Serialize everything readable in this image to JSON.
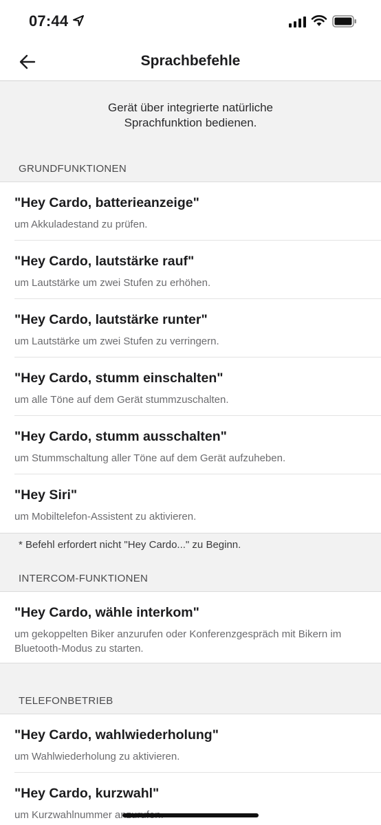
{
  "status_bar": {
    "time": "07:44",
    "location_icon": "location-arrow-icon",
    "signal_icon": "cellular-signal-icon",
    "wifi_icon": "wifi-icon",
    "battery_icon": "battery-icon"
  },
  "nav": {
    "back_icon": "arrow-left-icon",
    "title": "Sprachbefehle"
  },
  "intro": {
    "line1": "Gerät über integrierte natürliche",
    "line2": "Sprachfunktion bedienen."
  },
  "sections": {
    "grundfunktionen": {
      "header": "GRUNDFUNKTIONEN",
      "items": [
        {
          "command": "\"Hey Cardo, batterieanzeige\"",
          "description": "um Akkuladestand zu prüfen."
        },
        {
          "command": "\"Hey Cardo, lautstärke rauf\"",
          "description": "um Lautstärke um zwei Stufen zu erhöhen."
        },
        {
          "command": "\"Hey Cardo, lautstärke runter\"",
          "description": "um Lautstärke um zwei Stufen zu verringern."
        },
        {
          "command": "\"Hey Cardo, stumm einschalten\"",
          "description": "um alle Töne auf dem Gerät stummzuschalten."
        },
        {
          "command": "\"Hey Cardo, stumm ausschalten\"",
          "description": "um Stummschaltung aller Töne auf dem Gerät aufzuheben."
        },
        {
          "command": "\"Hey Siri\"",
          "description": "um Mobiltelefon-Assistent zu aktivieren."
        }
      ],
      "note": "* Befehl erfordert nicht \"Hey Cardo...\" zu Beginn."
    },
    "intercom": {
      "header": "INTERCOM-FUNKTIONEN",
      "items": [
        {
          "command": "\"Hey Cardo, wähle interkom\"",
          "description": "um gekoppelten Biker anzurufen oder Konferenzgespräch mit Bikern im Bluetooth-Modus zu starten."
        }
      ]
    },
    "telefon": {
      "header": "TELEFONBETRIEB",
      "items": [
        {
          "command": "\"Hey Cardo, wahlwiederholung\"",
          "description": "um Wahlwiederholung zu aktivieren."
        },
        {
          "command": "\"Hey Cardo, kurzwahl\"",
          "description": "um Kurzwahlnummer anzurufen."
        }
      ]
    }
  }
}
